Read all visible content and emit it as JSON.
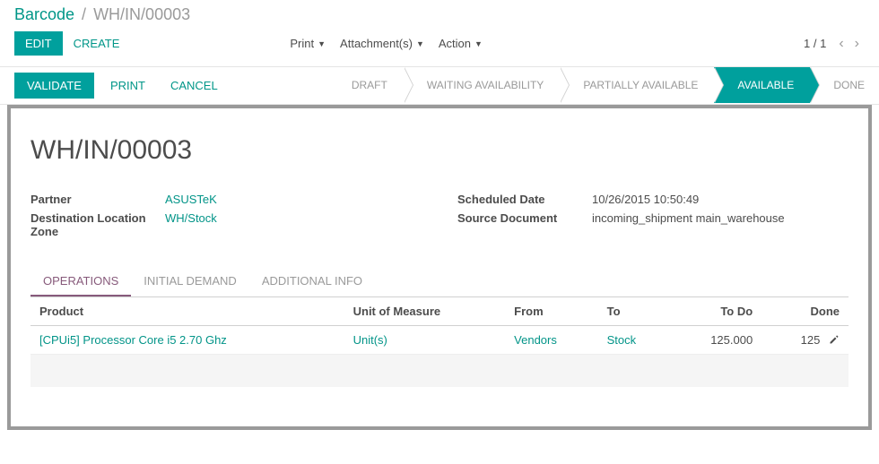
{
  "breadcrumb": {
    "root": "Barcode",
    "current": "WH/IN/00003"
  },
  "buttons": {
    "edit": "EDIT",
    "create": "CREATE",
    "validate": "VALIDATE",
    "print": "PRINT",
    "cancel": "CANCEL"
  },
  "menus": {
    "print": "Print",
    "attachments": "Attachment(s)",
    "action": "Action"
  },
  "pager": {
    "text": "1 / 1"
  },
  "status": {
    "draft": "DRAFT",
    "waiting": "WAITING AVAILABILITY",
    "partial": "PARTIALLY AVAILABLE",
    "available": "AVAILABLE",
    "done": "DONE"
  },
  "record": {
    "title": "WH/IN/00003",
    "labels": {
      "partner": "Partner",
      "dest": "Destination Location Zone",
      "sched": "Scheduled Date",
      "source": "Source Document"
    },
    "partner": "ASUSTeK",
    "dest": "WH/Stock",
    "sched": "10/26/2015 10:50:49",
    "source": "incoming_shipment main_warehouse"
  },
  "tabs": {
    "ops": "OPERATIONS",
    "initial": "INITIAL DEMAND",
    "additional": "ADDITIONAL INFO"
  },
  "cols": {
    "product": "Product",
    "uom": "Unit of Measure",
    "from": "From",
    "to": "To",
    "todo": "To Do",
    "done": "Done"
  },
  "lines": [
    {
      "product": "[CPUi5] Processor Core i5 2.70 Ghz",
      "uom": "Unit(s)",
      "from": "Vendors",
      "to": "Stock",
      "todo": "125.000",
      "done": "125"
    }
  ]
}
